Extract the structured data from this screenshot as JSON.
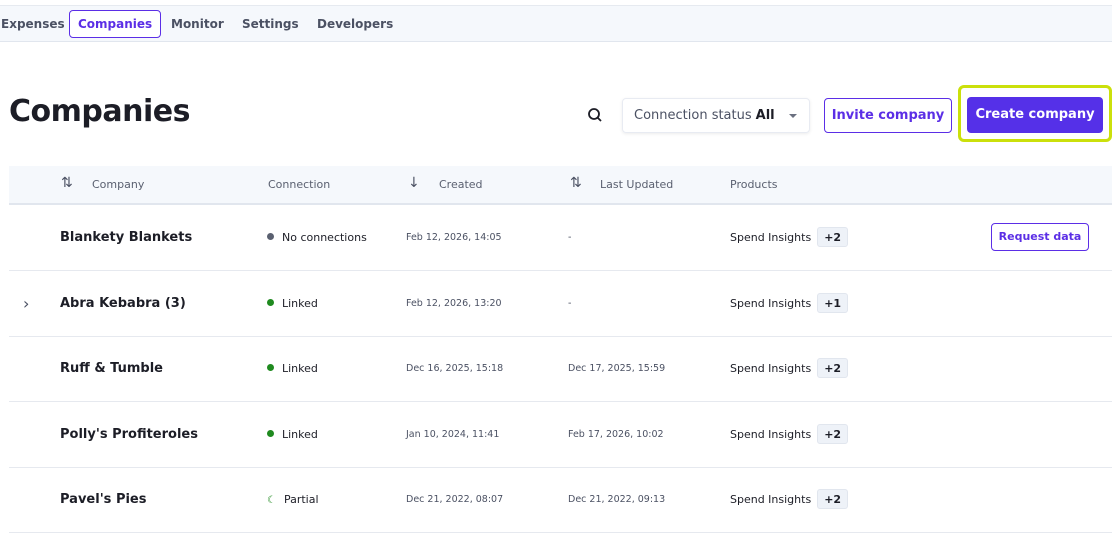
{
  "nav": {
    "items": [
      {
        "label": "Expenses"
      },
      {
        "label": "Companies",
        "active": true
      },
      {
        "label": "Monitor"
      },
      {
        "label": "Settings"
      },
      {
        "label": "Developers"
      }
    ]
  },
  "header": {
    "title": "Companies",
    "filter_label": "Connection status",
    "filter_value": "All",
    "invite_label": "Invite company",
    "create_label": "Create company"
  },
  "colors": {
    "accent": "#5530e8",
    "highlight": "#cbe00b",
    "linked": "#1f8a1f",
    "none": "#5a6070"
  },
  "table": {
    "columns": [
      "Company",
      "Connection",
      "Created",
      "Last Updated",
      "Products"
    ],
    "rows": [
      {
        "name": "Blankety Blankets",
        "connection": "No connections",
        "status": "none",
        "created": "Feb 12, 2026, 14:05",
        "updated": "-",
        "product": "Spend Insights",
        "extra": "+2",
        "action": "Request data"
      },
      {
        "name": "Abra Kebabra  (3)",
        "connection": "Linked",
        "status": "linked",
        "created": "Feb 12, 2026, 13:20",
        "updated": "-",
        "product": "Spend Insights",
        "extra": "+1",
        "expandable": true
      },
      {
        "name": "Ruff & Tumble",
        "connection": "Linked",
        "status": "linked",
        "created": "Dec 16, 2025, 15:18",
        "updated": "Dec 17, 2025, 15:59",
        "product": "Spend Insights",
        "extra": "+2"
      },
      {
        "name": "Polly's Profiteroles",
        "connection": "Linked",
        "status": "linked",
        "created": "Jan 10, 2024, 11:41",
        "updated": "Feb 17, 2026, 10:02",
        "product": "Spend Insights",
        "extra": "+2"
      },
      {
        "name": "Pavel's Pies",
        "connection": "Partial",
        "status": "partial",
        "created": "Dec 21, 2022, 08:07",
        "updated": "Dec 21, 2022, 09:13",
        "product": "Spend Insights",
        "extra": "+2"
      }
    ]
  }
}
